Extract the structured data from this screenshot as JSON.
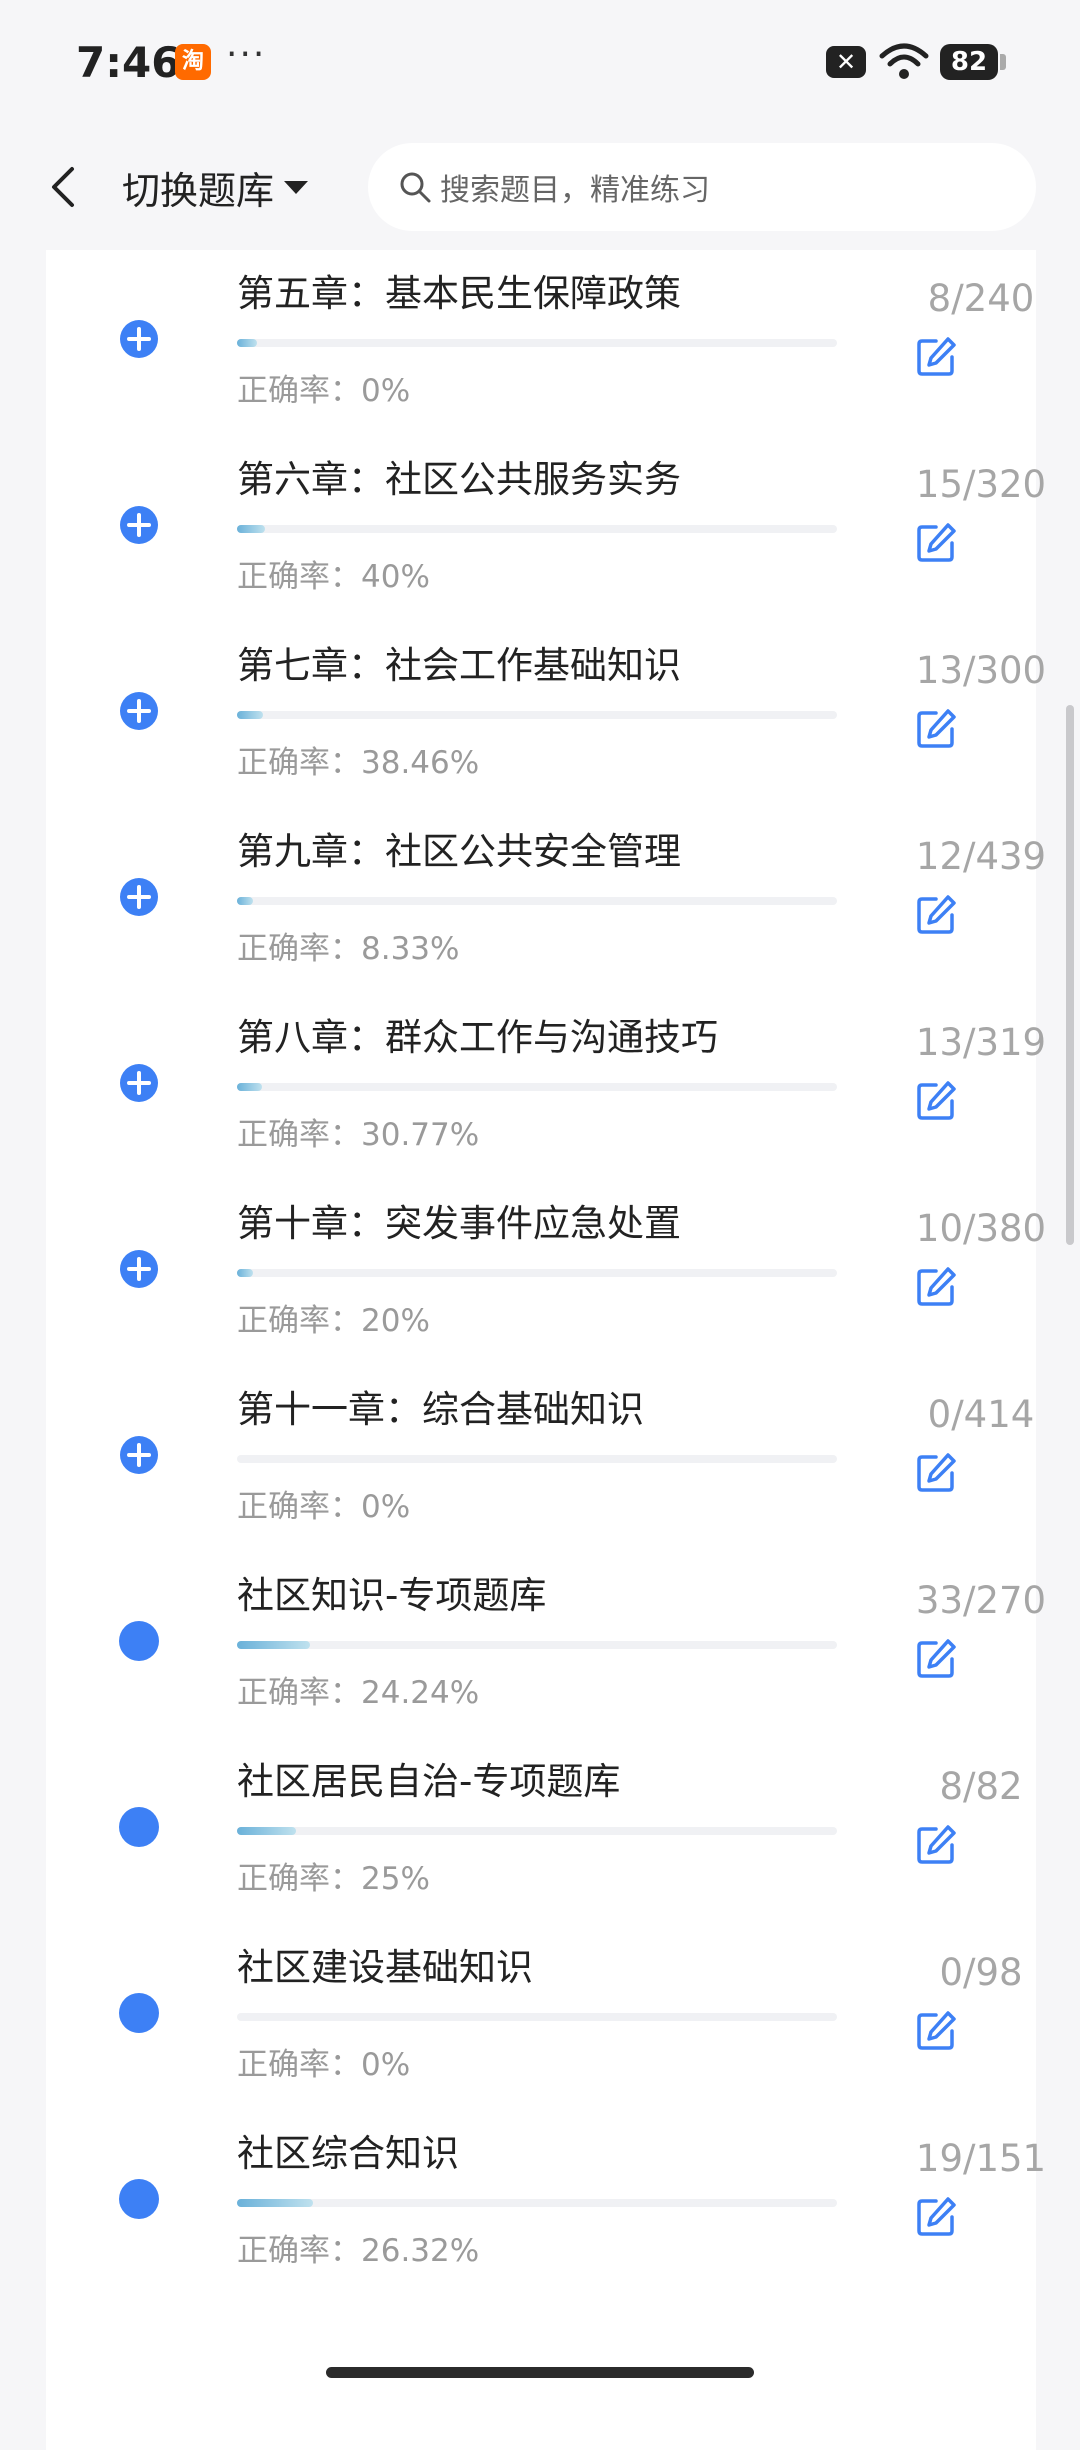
{
  "status_bar": {
    "time": "7:46",
    "app_badge": "淘",
    "more": "···",
    "notification_badge": "✕",
    "battery": "82"
  },
  "header": {
    "bank_switch_label": "切换题库",
    "search_placeholder": "搜索题目，精准练习"
  },
  "chapters": [
    {
      "title": "第五章：基本民生保障政策",
      "count": "8/240",
      "accuracy": "正确率：0%",
      "progress": 0.033,
      "icon": "plus-circle-icon"
    },
    {
      "title": "第六章：社区公共服务实务",
      "count": "15/320",
      "accuracy": "正确率：40%",
      "progress": 0.047,
      "icon": "plus-circle-icon"
    },
    {
      "title": "第七章：社会工作基础知识",
      "count": "13/300",
      "accuracy": "正确率：38.46%",
      "progress": 0.043,
      "icon": "plus-circle-icon"
    },
    {
      "title": "第九章：社区公共安全管理",
      "count": "12/439",
      "accuracy": "正确率：8.33%",
      "progress": 0.027,
      "icon": "plus-circle-icon"
    },
    {
      "title": "第八章：群众工作与沟通技巧",
      "count": "13/319",
      "accuracy": "正确率：30.77%",
      "progress": 0.041,
      "icon": "plus-circle-icon"
    },
    {
      "title": "第十章：突发事件应急处置",
      "count": "10/380",
      "accuracy": "正确率：20%",
      "progress": 0.026,
      "icon": "plus-circle-icon"
    },
    {
      "title": "第十一章：综合基础知识",
      "count": "0/414",
      "accuracy": "正确率：0%",
      "progress": 0,
      "icon": "plus-circle-icon"
    },
    {
      "title": "社区知识-专项题库",
      "count": "33/270",
      "accuracy": "正确率：24.24%",
      "progress": 0.122,
      "icon": "dot-icon"
    },
    {
      "title": "社区居民自治-专项题库",
      "count": "8/82",
      "accuracy": "正确率：25%",
      "progress": 0.098,
      "icon": "dot-icon"
    },
    {
      "title": "社区建设基础知识",
      "count": "0/98",
      "accuracy": "正确率：0%",
      "progress": 0,
      "icon": "dot-icon"
    },
    {
      "title": "社区综合知识",
      "count": "19/151",
      "accuracy": "正确率：26.32%",
      "progress": 0.126,
      "icon": "dot-icon"
    }
  ],
  "colors": {
    "accent": "#3d80f5",
    "progress_fill": "#6ab1d9",
    "muted_text": "#9a9a9a"
  }
}
